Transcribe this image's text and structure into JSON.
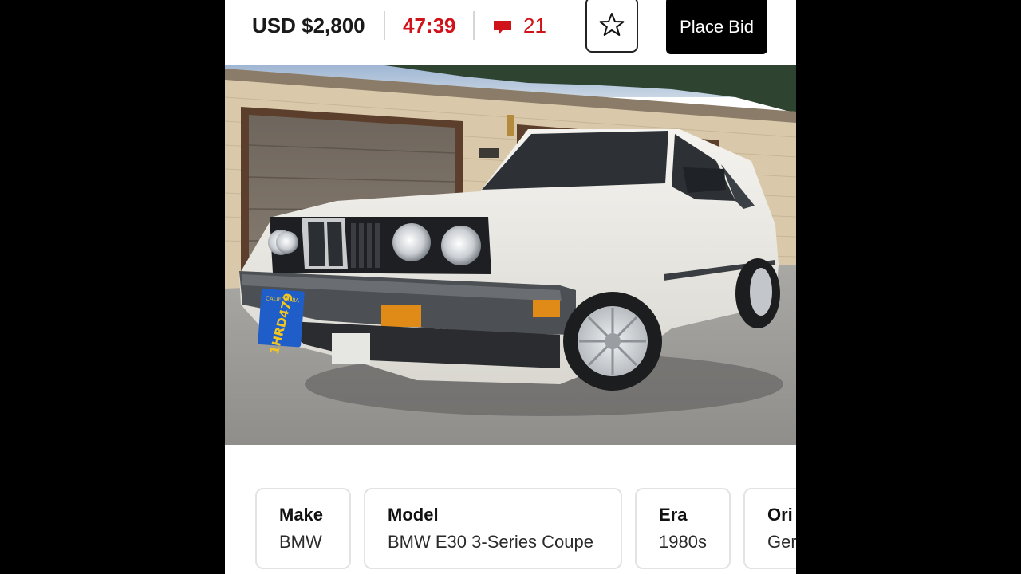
{
  "listing": {
    "price": "USD $2,800",
    "time_remaining": "47:39",
    "comment_count": "21",
    "place_bid_label": "Place Bid",
    "watch_icon": "star-icon",
    "comment_icon": "comment-bubble-icon"
  },
  "photo": {
    "plate_top": "CALIFORNIA",
    "plate_number": "1HRD479"
  },
  "specs": [
    {
      "label": "Make",
      "value": "BMW"
    },
    {
      "label": "Model",
      "value": "BMW E30 3-Series Coupe"
    },
    {
      "label": "Era",
      "value": "1980s"
    },
    {
      "label": "Ori",
      "value": "Ger"
    }
  ],
  "colors": {
    "accent_red": "#d0121b",
    "bid_button": "#000000"
  }
}
